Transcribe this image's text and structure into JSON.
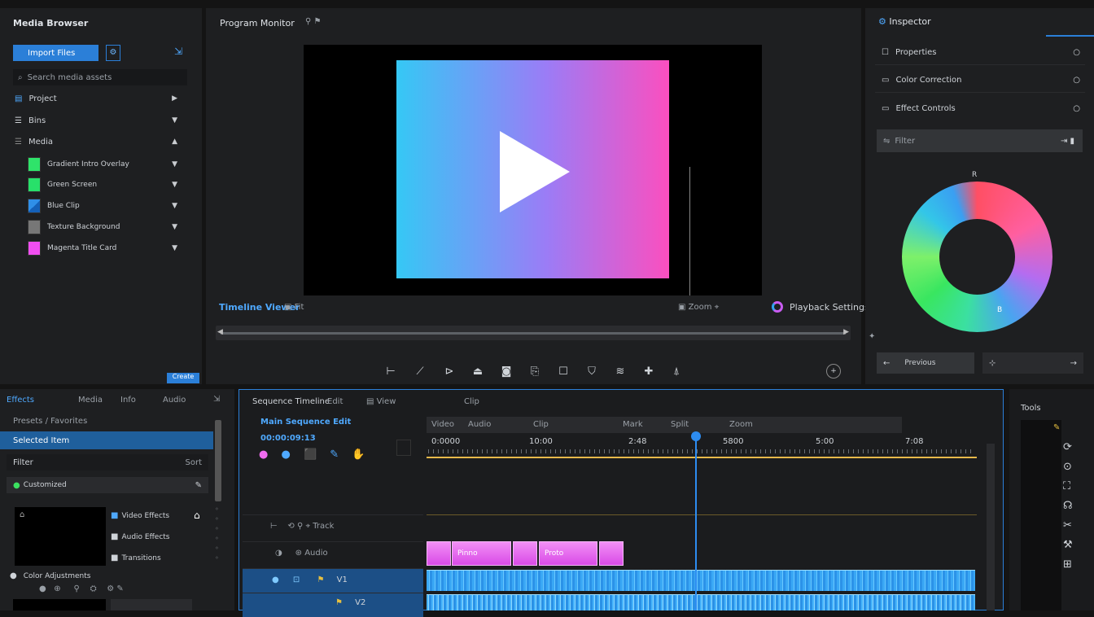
{
  "top_left": {
    "title": "Media Browser",
    "import_button": "Import Files",
    "search_placeholder": "Search media assets",
    "items": [
      {
        "label": "Project",
        "icon": "folder-icon"
      },
      {
        "label": "Bins",
        "icon": "list-icon"
      },
      {
        "label": "Media",
        "icon": "list-icon"
      }
    ],
    "media": [
      {
        "label": "Gradient Intro Overlay",
        "color": "#2fe36a"
      },
      {
        "label": "Green Screen",
        "color": "#28e06a"
      },
      {
        "label": "Blue Clip",
        "color": "#2f8fe8"
      },
      {
        "label": "Texture Background",
        "color": "#777777"
      },
      {
        "label": "Magenta Title Card",
        "color": "#f04ef0"
      }
    ],
    "footer_button": "Create"
  },
  "viewer": {
    "title": "Program Monitor",
    "label": "Timeline Viewer",
    "fit_label": "Fit",
    "zoom_label": "Zoom",
    "right_label": "Playback Settings",
    "gradient_start": "#35c8f5",
    "gradient_mid": "#9b7cf6",
    "gradient_end": "#fb4fbf"
  },
  "inspector": {
    "title": "Inspector",
    "items": [
      {
        "label": "Properties"
      },
      {
        "label": "Color Correction"
      },
      {
        "label": "Effect Controls"
      }
    ],
    "filter_placeholder": "Filter",
    "wheel_top_label": "R",
    "wheel_bottom_label": "B",
    "nav_label": "Previous"
  },
  "effects_panel": {
    "tabs": [
      "Effects",
      "Media",
      "Info",
      "Audio"
    ],
    "breadcrumb": "Presets / Favorites",
    "selected": "Selected Item",
    "filter_label": "Filter",
    "filter_right": "Sort",
    "search_value": "Customized",
    "preview_items": [
      {
        "label": "Video Effects"
      },
      {
        "label": "Audio Effects"
      },
      {
        "label": "Transitions"
      }
    ],
    "footer_label": "Color Adjustments"
  },
  "timeline": {
    "title": "Sequence Timeline",
    "menu_items": [
      "Edit",
      "View",
      "Clip"
    ],
    "sequence_name": "Main Sequence Edit",
    "timecode": "00:00:09:13",
    "ruler_labels": [
      "0:0000",
      "10:00",
      "2:48",
      "5800",
      "5:00",
      "7:08"
    ],
    "header_labels": [
      "Video",
      "Audio",
      "Clip",
      "Mark",
      "Split",
      "Zoom"
    ],
    "track_labels": [
      "Track",
      "Audio",
      "V1",
      "V2"
    ],
    "pink_clips": [
      "",
      "Pinno",
      "",
      "Proto",
      ""
    ]
  },
  "right_dock": {
    "title": "Tools"
  }
}
